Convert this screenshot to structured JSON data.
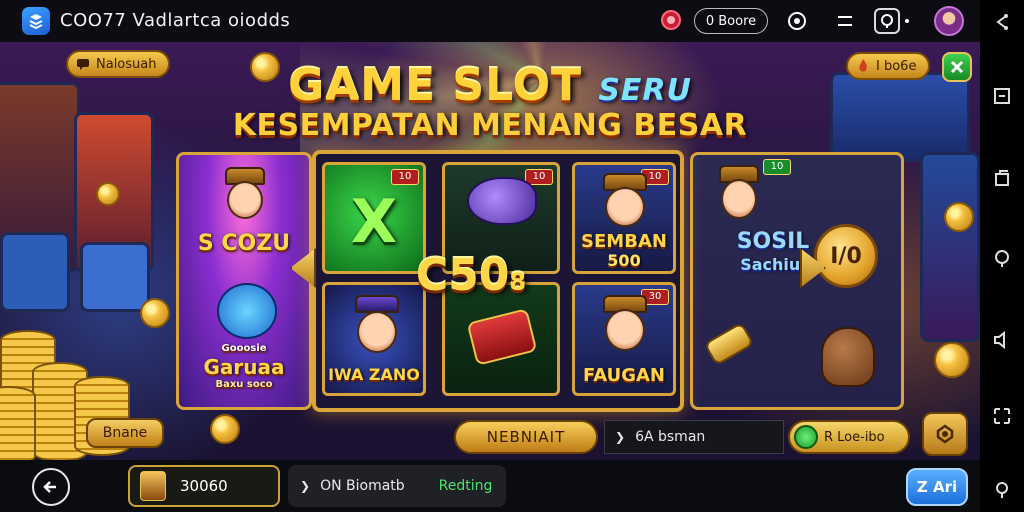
{
  "topbar": {
    "app_title": "COO77 Vadlartca oiodds",
    "pill_label": "0 Boore",
    "icons": [
      "gem-icon",
      "target-icon",
      "menu-icon",
      "steering-icon",
      "more-icon"
    ]
  },
  "banner": {
    "left_pill": "Nalosuah",
    "right_pill": "I bo6e",
    "title_main": "GAME SLOT",
    "title_accent": "SERU",
    "subtitle": "KESEMPATAN MENANG BESAR"
  },
  "panels": {
    "left_top_label": "S COZU",
    "left_bottom_label": "Garuaa",
    "left_bottom_small": "Gooosie",
    "left_bottom_tag": "Baxu soco",
    "right_label_1": "SOSIL",
    "right_label_2": "Sachiui",
    "bonus_coin": "I/0"
  },
  "reels": {
    "badge_1": "10",
    "badge_2": "10",
    "badge_3": "10",
    "badge_4": "10",
    "badge_5": "30",
    "center_big": "C50",
    "center_small": "8",
    "tile_sem_1": "SEMBAN",
    "tile_sem_2": "500",
    "tile_bottom_left": "IWA ZANO",
    "tile_bottom_right": "FAUGAN"
  },
  "actions": {
    "left_small": "Bnane",
    "gold_btn": "NEBNIAIT",
    "dark_btn": "6A bsman",
    "green_btn": "R Loe-ibo"
  },
  "bottombar": {
    "balance": "30060",
    "info_text": "ON Biomatb",
    "info_green": "Redting",
    "za_button": "Z Ari"
  },
  "rightnav": {
    "icons": [
      "share-icon",
      "minimize-icon",
      "copy-icon",
      "search-icon",
      "speaker-icon",
      "resize-icon",
      "location-icon"
    ]
  },
  "colors": {
    "gold": "#d9a63a",
    "title_yellow": "#ffd23a",
    "accent_blue": "#1d6fdc",
    "accent_green": "#1b9a2c"
  }
}
